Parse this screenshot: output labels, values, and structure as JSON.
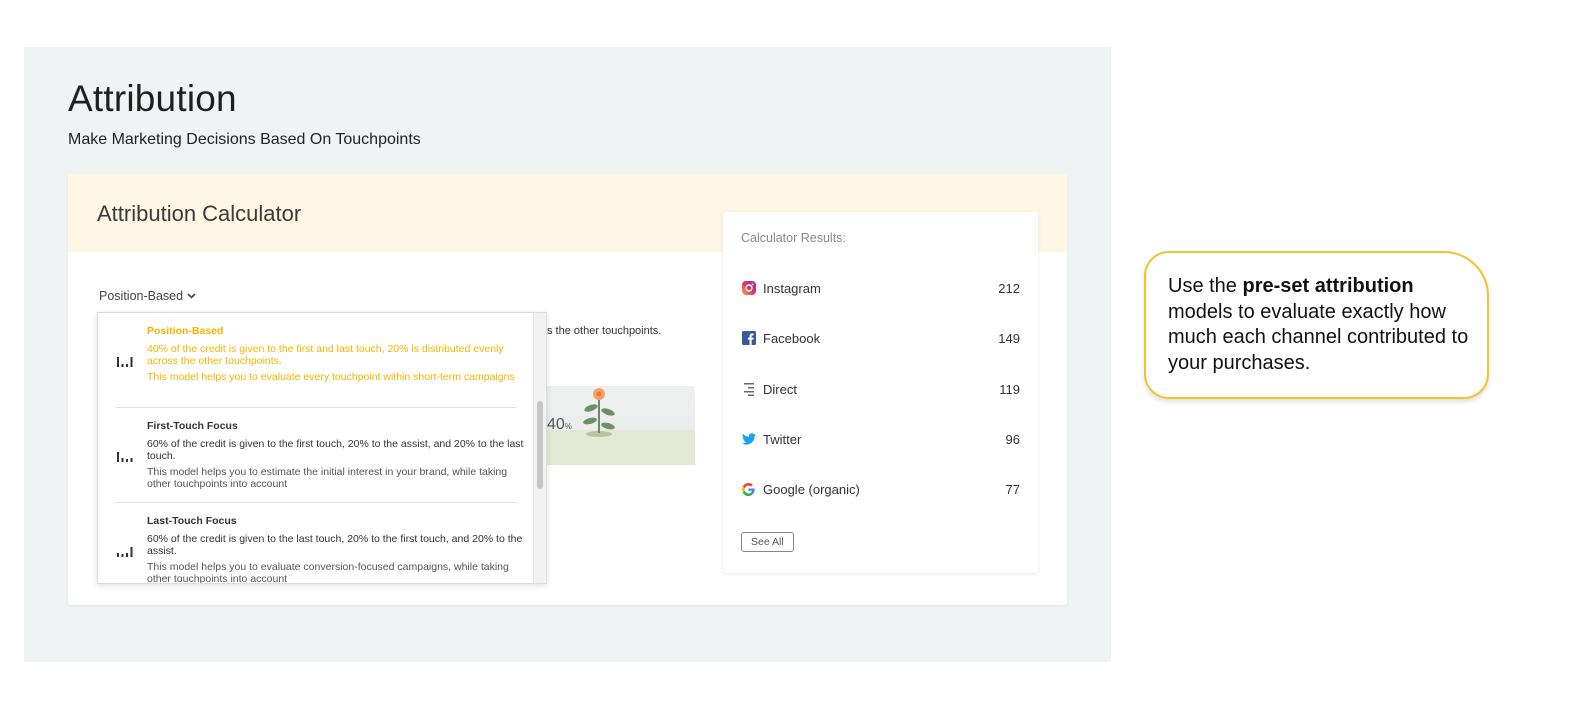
{
  "page": {
    "title": "Attribution",
    "subtitle": "Make Marketing Decisions Based On Touchpoints"
  },
  "calculator": {
    "title": "Attribution Calculator",
    "selected_model": "Position-Based",
    "background_text": "s the other touchpoints.",
    "illustration_value": "40",
    "illustration_unit": "%"
  },
  "dropdown": {
    "items": [
      {
        "name": "Position-Based",
        "description": "40% of the credit is given to the first and last touch, 20% is distributed evenly across the other touchpoints.",
        "help": "This model helps you to evaluate every touchpoint within short-term campaigns",
        "active": true
      },
      {
        "name": "First-Touch Focus",
        "description": "60% of the credit is given to the first touch, 20% to the assist, and 20% to the last touch.",
        "help": "This model helps you to estimate the initial interest in your brand, while taking other touchpoints into account",
        "active": false
      },
      {
        "name": "Last-Touch Focus",
        "description": "60% of the credit is given to the last touch, 20% to the first touch, and 20% to the assist.",
        "help": "This model helps you to evaluate conversion-focused campaigns, while taking other touchpoints into account",
        "active": false
      }
    ]
  },
  "results": {
    "title": "Calculator Results:",
    "rows": [
      {
        "name": "Instagram",
        "value": "212",
        "icon": "instagram-icon"
      },
      {
        "name": "Facebook",
        "value": "149",
        "icon": "facebook-icon"
      },
      {
        "name": "Direct",
        "value": "119",
        "icon": "direct-icon"
      },
      {
        "name": "Twitter",
        "value": "96",
        "icon": "twitter-icon"
      },
      {
        "name": "Google (organic)",
        "value": "77",
        "icon": "google-icon"
      }
    ],
    "see_all_label": "See All"
  },
  "callout": {
    "pre": "Use the ",
    "bold": "pre-set attribution",
    "post": " models to evaluate exactly how much each channel contributed to your purchases."
  },
  "colors": {
    "accent": "#f5b400",
    "callout_border": "#f5c12e",
    "header_bg": "#fef7e3",
    "panel_bg": "#f0f3f3"
  }
}
